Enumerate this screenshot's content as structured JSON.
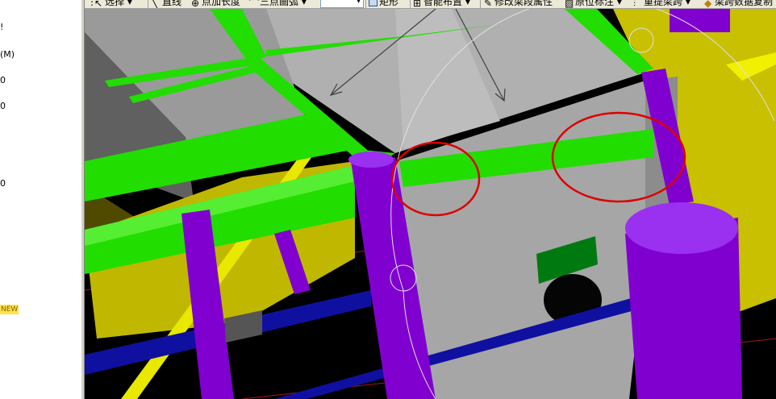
{
  "toolbar": {
    "select_label": "选择",
    "line_label": "直线",
    "point_length_label": "点加长度",
    "three_point_arc_label": "三点画弧",
    "combo_value": "",
    "rectangle_label": "矩形",
    "smart_layout_label": "智能布置",
    "modify_beam_label": "修改梁段属性",
    "origin_mark_label": "原位标注",
    "reextract_label": "重提梁跨",
    "copy_span_label": "梁跨数据复制"
  },
  "left_panel": {
    "items": [
      "!",
      "(M)",
      "0",
      "0",
      "0"
    ],
    "badge_label": "NEW"
  },
  "colors": {
    "beam_green": "#22dd00",
    "column_purple": "#8000d0",
    "slab_gray": "#a8a8a8",
    "wall_yellow": "#c8c000",
    "pipe_blue": "#1010a0",
    "highlight_red": "#dd0000"
  }
}
